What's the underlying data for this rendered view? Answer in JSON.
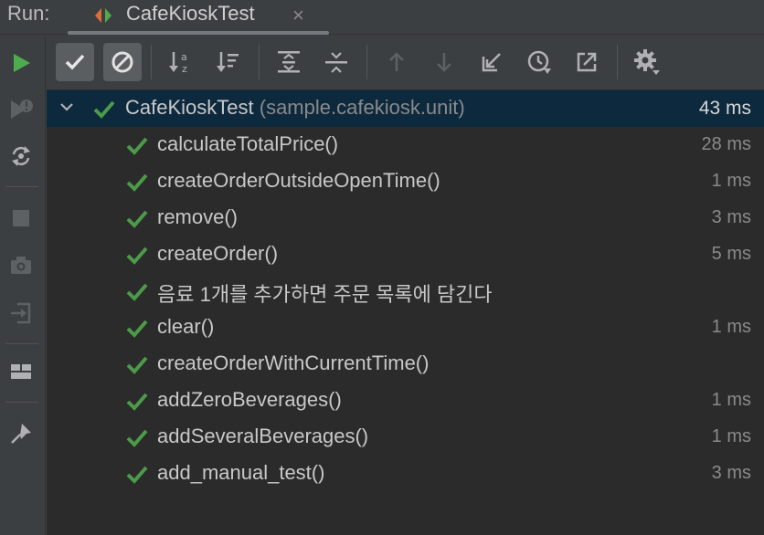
{
  "runbar": {
    "label": "Run:",
    "tab_title": "CafeKioskTest",
    "close_glyph": "×"
  },
  "left_toolbar": {
    "icons": [
      "rerun-icon",
      "rerun-failed-icon",
      "toggle-auto-test-icon",
      "stop-icon",
      "screenshot-icon",
      "export-icon",
      "layout-icon",
      "pin-icon"
    ]
  },
  "top_toolbar": {
    "icons": [
      "show-passed-icon",
      "show-ignored-icon",
      "sort-alpha-icon",
      "sort-duration-icon",
      "expand-all-icon",
      "collapse-all-icon",
      "previous-failed-icon",
      "next-failed-icon",
      "import-tests-icon",
      "test-history-icon",
      "export-results-icon",
      "settings-icon"
    ]
  },
  "tree": {
    "root": {
      "name": "CafeKioskTest",
      "package": "(sample.cafekiosk.unit)",
      "time": "43 ms"
    },
    "tests": [
      {
        "name": "calculateTotalPrice()",
        "time": "28 ms"
      },
      {
        "name": "createOrderOutsideOpenTime()",
        "time": "1 ms"
      },
      {
        "name": "remove()",
        "time": "3 ms"
      },
      {
        "name": "createOrder()",
        "time": "5 ms"
      },
      {
        "name": "음료 1개를 추가하면 주문 목록에 담긴다",
        "time": ""
      },
      {
        "name": "clear()",
        "time": "1 ms"
      },
      {
        "name": "createOrderWithCurrentTime()",
        "time": ""
      },
      {
        "name": "addZeroBeverages()",
        "time": "1 ms"
      },
      {
        "name": "addSeveralBeverages()",
        "time": "1 ms"
      },
      {
        "name": "add_manual_test()",
        "time": "3 ms"
      }
    ]
  },
  "colors": {
    "pass_green": "#4c9b49",
    "run_green": "#4eac4e",
    "selection": "#0d293e"
  }
}
